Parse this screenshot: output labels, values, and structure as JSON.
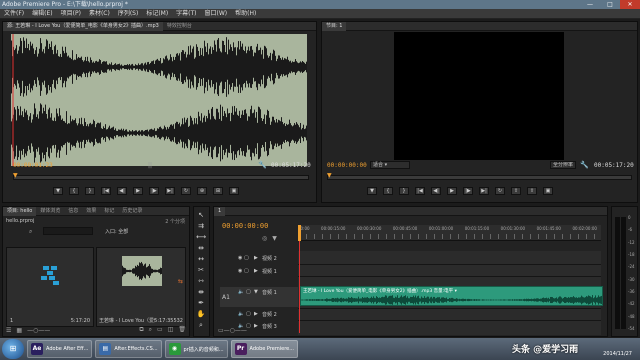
{
  "window": {
    "title": "Adobe Premiere Pro - E:\\下载\\hello.prproj *"
  },
  "menu": [
    "文件(F)",
    "编辑(E)",
    "项目(P)",
    "素材(C)",
    "序列(S)",
    "标记(M)",
    "字幕(T)",
    "窗口(W)",
    "帮助(H)"
  ],
  "source": {
    "tabs": [
      "源: 王若琳 - I Love You（爱便简单_电影《单身男女2》插曲）.mp3",
      "特效控制台"
    ],
    "tc_current": "00:00:01:23",
    "tc_duration": "00:05:17:20"
  },
  "program": {
    "tab": "节目: 1",
    "tc_current": "00:00:00:00",
    "tc_duration": "00:05:17:20",
    "fit": "适合",
    "quality": "全分辨率"
  },
  "project": {
    "tabs": [
      "项目: hello",
      "媒体浏览",
      "信息",
      "效果",
      "标记",
      "历史记录"
    ],
    "file": "hello.prproj",
    "count": "2 个分项",
    "in_label": "入口: 全部",
    "item1_dur": "5:17:20",
    "item1_idx": "1",
    "item2_name": "王若琳 - I Love You（爱便简单_电影",
    "item2_dur": "5:17:35532"
  },
  "timeline": {
    "tab": "1",
    "tc": "00:00:00:00",
    "ruler": [
      "00:00",
      "00:00:15:00",
      "00:00:30:00",
      "00:00:45:00",
      "00:01:00:00",
      "00:01:15:00",
      "00:01:30:00",
      "00:01:45:00",
      "00:02:00:00"
    ],
    "tracks": [
      {
        "name": "视频 2",
        "kind": "video"
      },
      {
        "name": "视频 1",
        "kind": "video"
      },
      {
        "name": "音频 1",
        "kind": "audio"
      },
      {
        "name": "音频 2",
        "kind": "audio"
      },
      {
        "name": "音频 3",
        "kind": "audio"
      }
    ],
    "a1_label": "A1",
    "clip_label": "王若琳 - I Love You（爱便简单_电影《单身男女2》插曲）.mp3 音量:电平 ▾"
  },
  "meter_ticks": [
    "0",
    "-6",
    "-12",
    "-18",
    "-24",
    "-30",
    "-36",
    "-42",
    "-48",
    "-54"
  ],
  "taskbar": {
    "items": [
      {
        "icon": "Ae",
        "label": "Adobe After Eff...",
        "color": "#2a1f5e"
      },
      {
        "icon": "▤",
        "label": "After.Effects.CS...",
        "color": "#3a6aa8"
      },
      {
        "icon": "◉",
        "label": "pr插入的音频和...",
        "color": "#2a9a3a"
      },
      {
        "icon": "Pr",
        "label": "Adobe Premiere...",
        "color": "#4a1f5e"
      }
    ],
    "watermark": "头条 @爱学习雨",
    "date": "2014/11/27"
  }
}
